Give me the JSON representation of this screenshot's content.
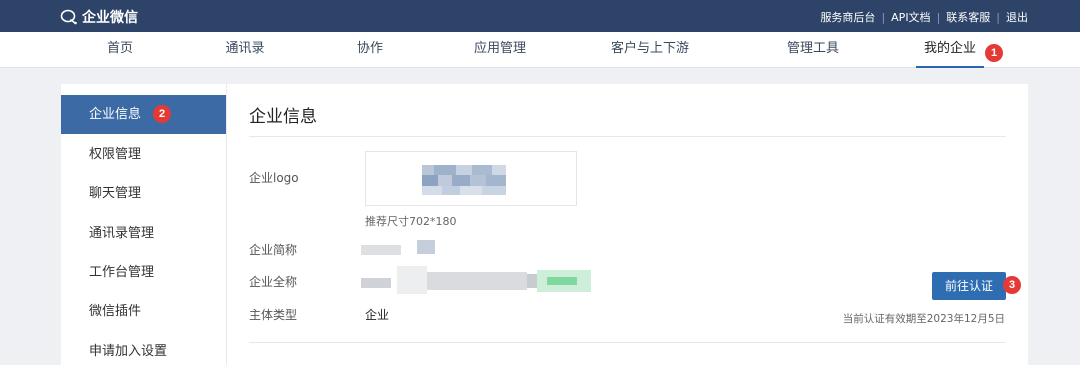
{
  "header": {
    "brand": "企业微信",
    "links": [
      "服务商后台",
      "API文档",
      "联系客服",
      "退出"
    ]
  },
  "nav": {
    "items": [
      "首页",
      "通讯录",
      "协作",
      "应用管理",
      "客户与上下游",
      "管理工具",
      "我的企业"
    ],
    "active": "我的企业",
    "badge": "1"
  },
  "sidebar": {
    "items": [
      "企业信息",
      "权限管理",
      "聊天管理",
      "通讯录管理",
      "工作台管理",
      "微信插件",
      "申请加入设置"
    ],
    "active": "企业信息",
    "badge": "2"
  },
  "main": {
    "title": "企业信息",
    "logo_label": "企业logo",
    "logo_hint": "推荐尺寸702*180",
    "short_name_label": "企业简称",
    "full_name_label": "企业全称",
    "type_label": "主体类型",
    "type_value": "企业",
    "cert_button": "前往认证",
    "cert_badge": "3",
    "cert_note": "当前认证有效期至2023年12月5日"
  },
  "colors": {
    "topbar": "#2d4468",
    "active_side": "#3b6aa4",
    "button": "#2f6db3",
    "badge": "#e53935"
  }
}
